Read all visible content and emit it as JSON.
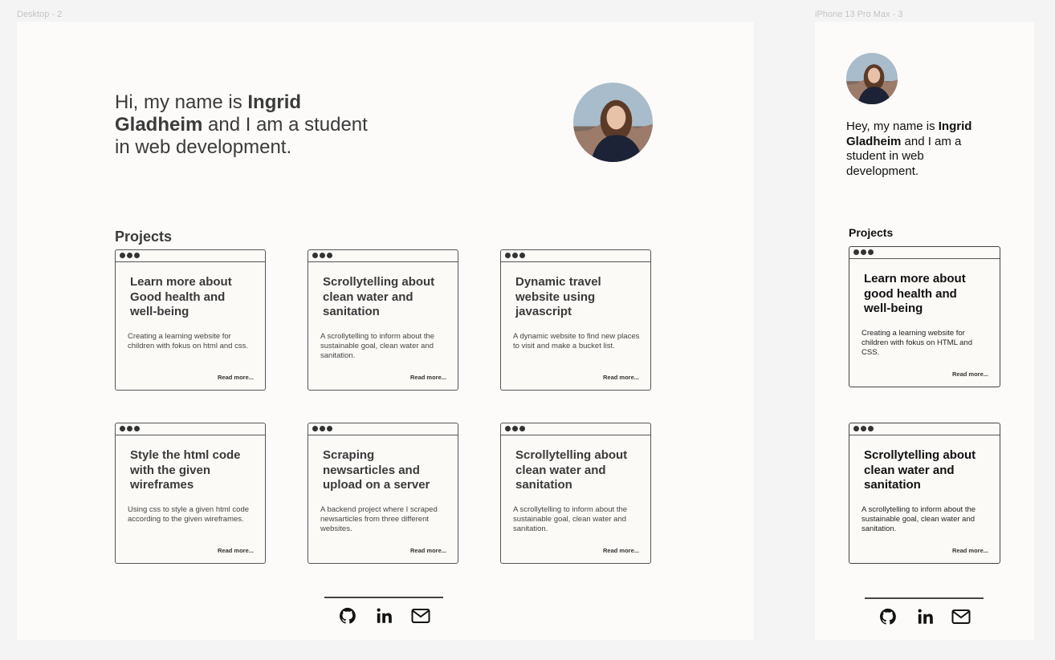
{
  "frames": {
    "desktop_label": "Desktop - 2",
    "mobile_label": "iPhone 13 Pro Max - 3"
  },
  "desktop": {
    "intro": {
      "pre": "Hi, my name is ",
      "name": "Ingrid Gladheim",
      "post": " and I am a student in web development."
    },
    "projects_title": "Projects",
    "cards": [
      {
        "title": "Learn more about Good health and well-being",
        "desc": "Creating a learning website for children with fokus on html and css.",
        "more": "Read more..."
      },
      {
        "title": "Scrollytelling about clean water and sanitation",
        "desc": "A scrollytelling to inform about the sustainable goal, clean water and sanitation.",
        "more": "Read more..."
      },
      {
        "title": "Dynamic travel website using javascript",
        "desc": "A dynamic website to find new places to visit and make a bucket list.",
        "more": "Read more..."
      },
      {
        "title": "Style the html code with the given wireframes",
        "desc": "Using css to style a given html code according to the given wireframes.",
        "more": "Read more..."
      },
      {
        "title": "Scraping newsarticles and upload on a server",
        "desc": "A backend project where I scraped newsarticles from three different websites.",
        "more": "Read more..."
      },
      {
        "title": "Scrollytelling about clean water and sanitation",
        "desc": "A scrollytelling to inform about the sustainable goal, clean water and sanitation.",
        "more": "Read more..."
      }
    ]
  },
  "mobile": {
    "intro": {
      "pre": "Hey, my name is ",
      "name": "Ingrid Gladheim",
      "post": " and I am a student in web development."
    },
    "projects_title": "Projects",
    "cards": [
      {
        "title": "Learn more about good health and well-being",
        "desc": "Creating a learning website for children with fokus on HTML and CSS.",
        "more": "Read more..."
      },
      {
        "title": "Scrollytelling about clean water and sanitation",
        "desc": "A scrollytelling to inform about the sustainable goal, clean water and sanitation.",
        "more": "Read more..."
      }
    ]
  },
  "icons": {
    "github": "github-icon",
    "linkedin": "linkedin-icon",
    "mail": "mail-icon"
  },
  "colors": {
    "page_bg": "#f4f4f4",
    "frame_bg": "#fcfbf9",
    "text": "#3b3b3b"
  }
}
